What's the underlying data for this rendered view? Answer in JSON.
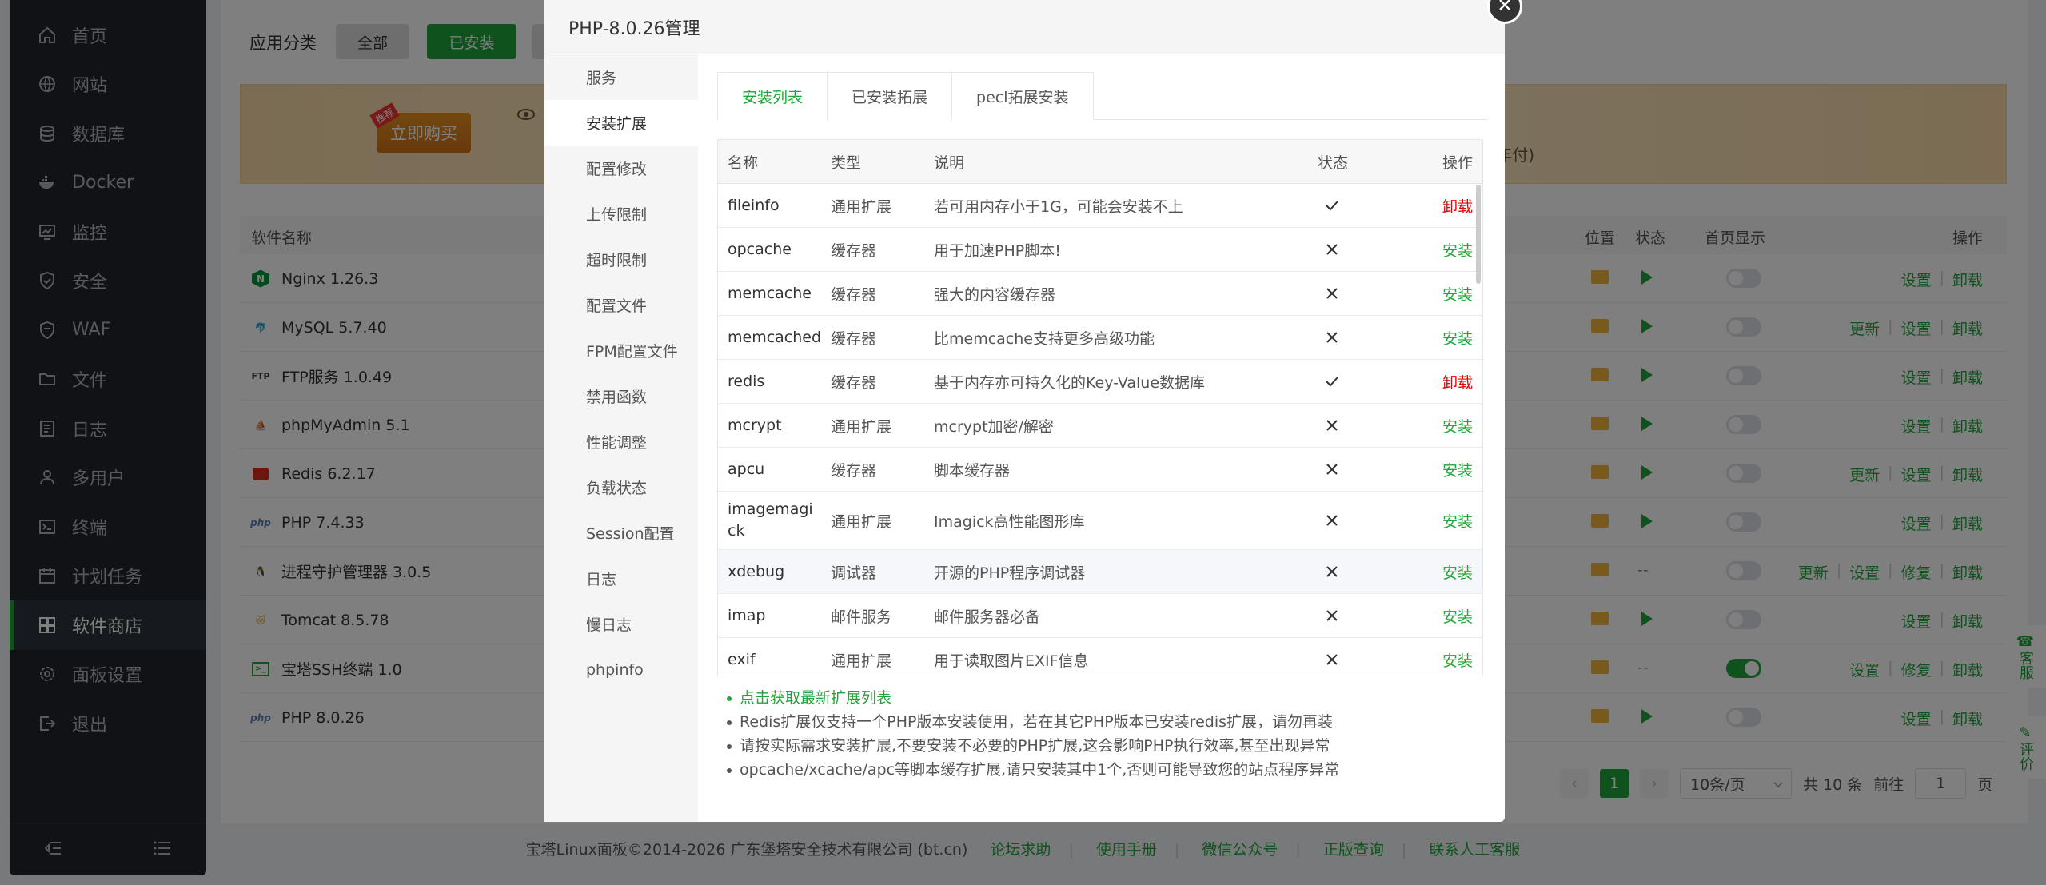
{
  "sidebar": {
    "items": [
      {
        "label": "首页",
        "icon": "home-icon"
      },
      {
        "label": "网站",
        "icon": "globe-icon"
      },
      {
        "label": "数据库",
        "icon": "database-icon"
      },
      {
        "label": "Docker",
        "icon": "docker-icon"
      },
      {
        "label": "监控",
        "icon": "monitor-icon"
      },
      {
        "label": "安全",
        "icon": "shield-icon"
      },
      {
        "label": "WAF",
        "icon": "waf-shield-icon"
      },
      {
        "label": "文件",
        "icon": "folder-icon"
      },
      {
        "label": "日志",
        "icon": "log-icon"
      },
      {
        "label": "多用户",
        "icon": "users-icon"
      },
      {
        "label": "终端",
        "icon": "terminal-icon"
      },
      {
        "label": "计划任务",
        "icon": "schedule-icon"
      },
      {
        "label": "软件商店",
        "icon": "grid-icon",
        "active": true
      },
      {
        "label": "面板设置",
        "icon": "gear-icon"
      },
      {
        "label": "退出",
        "icon": "logout-icon"
      }
    ]
  },
  "store": {
    "category_label": "应用分类",
    "category_buttons": [
      "全部",
      "已安装"
    ],
    "banner_buy": "立即购买",
    "banner_badge": "推荐",
    "banner_suffix": "(年付)",
    "headers": {
      "name": "软件名称",
      "location": "位置",
      "status": "状态",
      "homepage": "首页显示",
      "ops": "操作"
    },
    "rows": [
      {
        "name": "Nginx 1.26.3",
        "logo": "nginx-logo-icon",
        "run": "play",
        "home": false,
        "ops": [
          "设置",
          "卸载"
        ]
      },
      {
        "name": "MySQL 5.7.40",
        "logo": "mysql-logo-icon",
        "run": "play",
        "home": false,
        "ops": [
          "更新",
          "设置",
          "卸载"
        ]
      },
      {
        "name": "FTP服务 1.0.49",
        "logo": "ftp-logo-icon",
        "run": "play",
        "home": false,
        "ops": [
          "设置",
          "卸载"
        ]
      },
      {
        "name": "phpMyAdmin 5.1",
        "logo": "phpmyadmin-logo-icon",
        "run": "play",
        "home": false,
        "ops": [
          "设置",
          "卸载"
        ]
      },
      {
        "name": "Redis 6.2.17",
        "logo": "redis-logo-icon",
        "run": "play",
        "home": false,
        "ops": [
          "更新",
          "设置",
          "卸载"
        ]
      },
      {
        "name": "PHP 7.4.33",
        "logo": "php-logo-icon",
        "run": "play",
        "home": false,
        "ops": [
          "设置",
          "卸载"
        ]
      },
      {
        "name": "进程守护管理器 3.0.5",
        "logo": "linux-penguin-icon",
        "run": "--",
        "home": false,
        "ops": [
          "更新",
          "设置",
          "修复",
          "卸载"
        ]
      },
      {
        "name": "Tomcat 8.5.78",
        "logo": "tomcat-logo-icon",
        "run": "play",
        "home": false,
        "ops": [
          "设置",
          "卸载"
        ]
      },
      {
        "name": "宝塔SSH终端 1.0",
        "logo": "ssh-terminal-icon",
        "run": "--",
        "home": true,
        "ops": [
          "设置",
          "修复",
          "卸载"
        ]
      },
      {
        "name": "PHP 8.0.26",
        "logo": "php-logo-icon",
        "run": "play",
        "home": false,
        "ops": [
          "设置",
          "卸载"
        ]
      }
    ],
    "pager": {
      "current": "1",
      "page_size": "10条/页",
      "total": "共 10 条",
      "goto_label": "前往",
      "goto_value": "1",
      "page_suffix": "页"
    }
  },
  "float": {
    "service": "客服",
    "review": "评价"
  },
  "footer": {
    "copyright": "宝塔Linux面板©2014-2026 广东堡塔安全技术有限公司 (bt.cn)",
    "links": [
      "论坛求助",
      "使用手册",
      "微信公众号",
      "正版查询",
      "联系人工客服"
    ]
  },
  "modal": {
    "title": "PHP-8.0.26管理",
    "nav": [
      "服务",
      "安装扩展",
      "配置修改",
      "上传限制",
      "超时限制",
      "配置文件",
      "FPM配置文件",
      "禁用函数",
      "性能调整",
      "负载状态",
      "Session配置",
      "日志",
      "慢日志",
      "phpinfo"
    ],
    "active_nav": 1,
    "tabs": [
      "安装列表",
      "已安装拓展",
      "pecl拓展安装"
    ],
    "table": {
      "headers": {
        "name": "名称",
        "type": "类型",
        "desc": "说明",
        "status": "状态",
        "op": "操作"
      },
      "rows": [
        {
          "name": "fileinfo",
          "type": "通用扩展",
          "desc": "若可用内存小于1G，可能会安装不上",
          "installed": true,
          "op": "卸载"
        },
        {
          "name": "opcache",
          "type": "缓存器",
          "desc": "用于加速PHP脚本!",
          "installed": false,
          "op": "安装"
        },
        {
          "name": "memcache",
          "type": "缓存器",
          "desc": "强大的内容缓存器",
          "installed": false,
          "op": "安装"
        },
        {
          "name": "memcached",
          "type": "缓存器",
          "desc": "比memcache支持更多高级功能",
          "installed": false,
          "op": "安装"
        },
        {
          "name": "redis",
          "type": "缓存器",
          "desc": "基于内存亦可持久化的Key-Value数据库",
          "installed": true,
          "op": "卸载"
        },
        {
          "name": "mcrypt",
          "type": "通用扩展",
          "desc": "mcrypt加密/解密",
          "installed": false,
          "op": "安装"
        },
        {
          "name": "apcu",
          "type": "缓存器",
          "desc": "脚本缓存器",
          "installed": false,
          "op": "安装"
        },
        {
          "name": "imagemagick",
          "name_line1": "imagemagi",
          "name_line2": "ck",
          "type": "通用扩展",
          "desc": "Imagick高性能图形库",
          "installed": false,
          "op": "安装"
        },
        {
          "name": "xdebug",
          "type": "调试器",
          "desc": "开源的PHP程序调试器",
          "installed": false,
          "op": "安装"
        },
        {
          "name": "imap",
          "type": "邮件服务",
          "desc": "邮件服务器必备",
          "installed": false,
          "op": "安装"
        },
        {
          "name": "exif",
          "type": "通用扩展",
          "desc": "用于读取图片EXIF信息",
          "installed": false,
          "op": "安装"
        }
      ]
    },
    "tips": [
      "点击获取最新扩展列表",
      "Redis扩展仅支持一个PHP版本安装使用，若在其它PHP版本已安装redis扩展，请勿再装",
      "请按实际需求安装扩展,不要安装不必要的PHP扩展,这会影响PHP执行效率,甚至出现异常",
      "opcache/xcache/apc等脚本缓存扩展,请只安装其中1个,否则可能导致您的站点程序异常"
    ]
  },
  "colors": {
    "accent": "#20a53a",
    "danger": "#ee0000",
    "sidebar": "#20242b"
  }
}
